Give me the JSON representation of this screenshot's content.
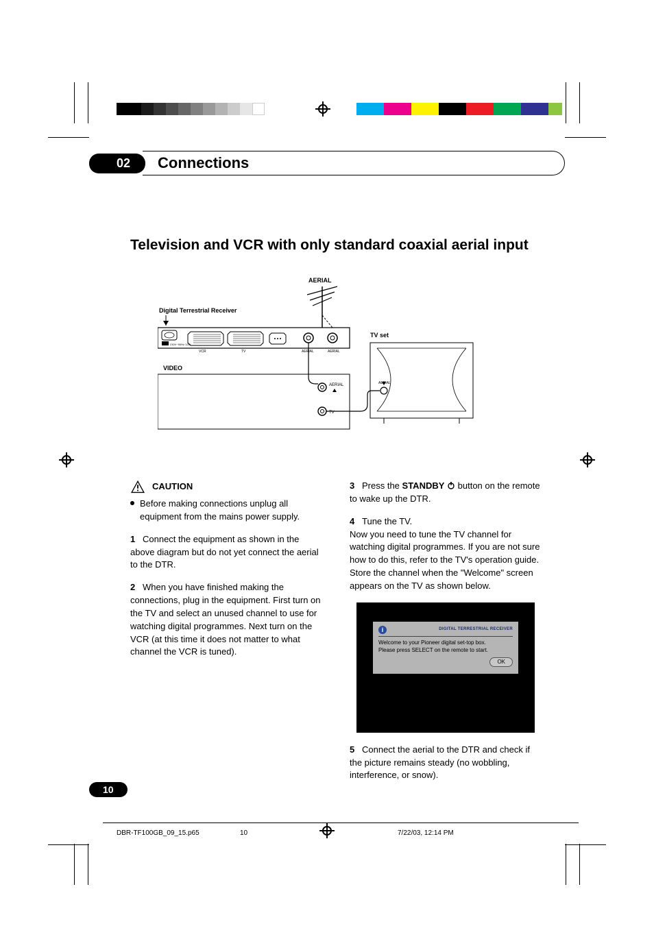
{
  "chapter": {
    "number": "02",
    "title": "Connections"
  },
  "section_title": "Television and VCR with only standard coaxial aerial input",
  "diagram": {
    "aerial_label": "AERIAL",
    "dtr_label": "Digital Terrestrial Receiver",
    "tvset_label": "TV set",
    "video_label": "VIDEO",
    "port_vcr": "VCR",
    "port_tv": "TV",
    "port_aerial_small": "AERIAL",
    "port_aerial_in": "AERIAL",
    "vcr_aerial": "AERIAL",
    "vcr_tv": "TV",
    "tv_aerial": "AERIAL"
  },
  "caution": {
    "heading": "CAUTION",
    "bullet": "Before making connections unplug all equipment from the mains power supply."
  },
  "steps_left": [
    {
      "n": "1",
      "text": "Connect the equipment as shown in the above diagram but do not yet connect the aerial to the DTR."
    },
    {
      "n": "2",
      "text": "When you have finished making the connections, plug in the equipment. First turn on the TV and select an unused channel to use for watching digital programmes. Next turn on the VCR (at this time it does not matter to what channel the VCR is tuned)."
    }
  ],
  "steps_right": {
    "s3_pre": "Press the ",
    "s3_bold": "STANDBY",
    "s3_post": " button on the remote to wake up the DTR.",
    "s3_n": "3",
    "s4_n": "4",
    "s4_head": "Tune the TV.",
    "s4_body": "Now you need to tune the TV channel for watching digital programmes. If you are not sure how to do this, refer to the TV's operation guide. Store the channel when the \"Welcome\" screen appears on the TV as shown below.",
    "s5_n": "5",
    "s5_text": "Connect the aerial to the DTR and check if the picture remains steady (no wobbling, interference, or snow)."
  },
  "welcome": {
    "header": "DIGITAL TERRESTRIAL RECEIVER",
    "line1": "Welcome to your Pioneer digital set-top box.",
    "line2": "Please press SELECT on the remote to start.",
    "ok": "OK"
  },
  "page_number": "10",
  "footer": {
    "filename": "DBR-TF100GB_09_15.p65",
    "page": "10",
    "datetime": "7/22/03, 12:14 PM"
  }
}
